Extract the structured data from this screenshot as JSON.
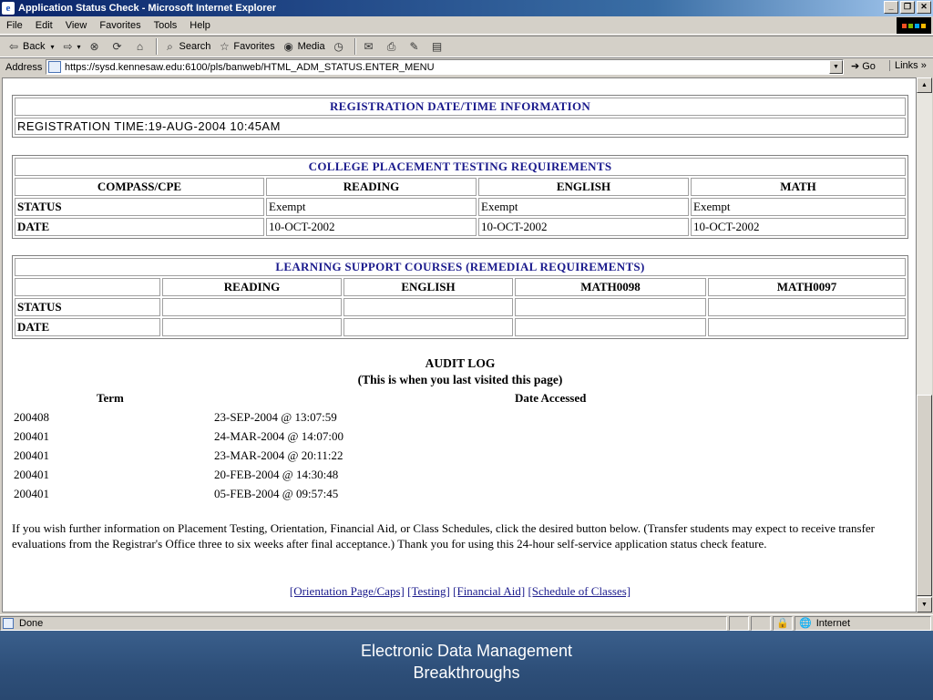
{
  "window": {
    "title": "Application Status Check - Microsoft Internet Explorer"
  },
  "menu": [
    "File",
    "Edit",
    "View",
    "Favorites",
    "Tools",
    "Help"
  ],
  "toolbar": {
    "back": "Back",
    "search": "Search",
    "favorites": "Favorites",
    "media": "Media"
  },
  "address": {
    "label": "Address",
    "url": "https://sysd.kennesaw.edu:6100/pls/banweb/HTML_ADM_STATUS.ENTER_MENU",
    "go": "Go",
    "links": "Links"
  },
  "registration": {
    "header": "REGISTRATION DATE/TIME INFORMATION",
    "value": "REGISTRATION TIME:19-AUG-2004 10:45AM"
  },
  "placement": {
    "header": "COLLEGE PLACEMENT TESTING REQUIREMENTS",
    "columns": [
      "COMPASS/CPE",
      "READING",
      "ENGLISH",
      "MATH"
    ],
    "rows": [
      {
        "label": "STATUS",
        "values": [
          "Exempt",
          "Exempt",
          "Exempt"
        ]
      },
      {
        "label": "DATE",
        "values": [
          "10-OCT-2002",
          "10-OCT-2002",
          "10-OCT-2002"
        ]
      }
    ]
  },
  "learning": {
    "header": "LEARNING SUPPORT COURSES (REMEDIAL REQUIREMENTS)",
    "columns": [
      "",
      "READING",
      "ENGLISH",
      "MATH0098",
      "MATH0097"
    ],
    "rows": [
      {
        "label": "STATUS"
      },
      {
        "label": "DATE"
      }
    ]
  },
  "audit": {
    "title": "AUDIT LOG",
    "subtitle": "(This is when you last visited this page)",
    "term_header": "Term",
    "date_header": "Date Accessed",
    "rows": [
      {
        "term": "200408",
        "date": "23-SEP-2004 @ 13:07:59"
      },
      {
        "term": "200401",
        "date": "24-MAR-2004 @ 14:07:00"
      },
      {
        "term": "200401",
        "date": "23-MAR-2004 @ 20:11:22"
      },
      {
        "term": "200401",
        "date": "20-FEB-2004 @ 14:30:48"
      },
      {
        "term": "200401",
        "date": "05-FEB-2004 @ 09:57:45"
      }
    ]
  },
  "info_text": "If you wish further information on Placement Testing, Orientation, Financial Aid, or Class Schedules, click the desired button below. (Transfer students may expect to receive transfer evaluations from the Registrar's Office three to six weeks after final acceptance.) Thank you for using this 24-hour self-service application status check feature.",
  "links": [
    "[Orientation Page/Caps]",
    "[Testing]",
    "[Financial Aid]",
    "[Schedule of Classes]"
  ],
  "status": {
    "text": "Done",
    "zone": "Internet"
  },
  "slide_caption": {
    "line1": "Electronic Data Management",
    "line2": "Breakthroughs"
  }
}
